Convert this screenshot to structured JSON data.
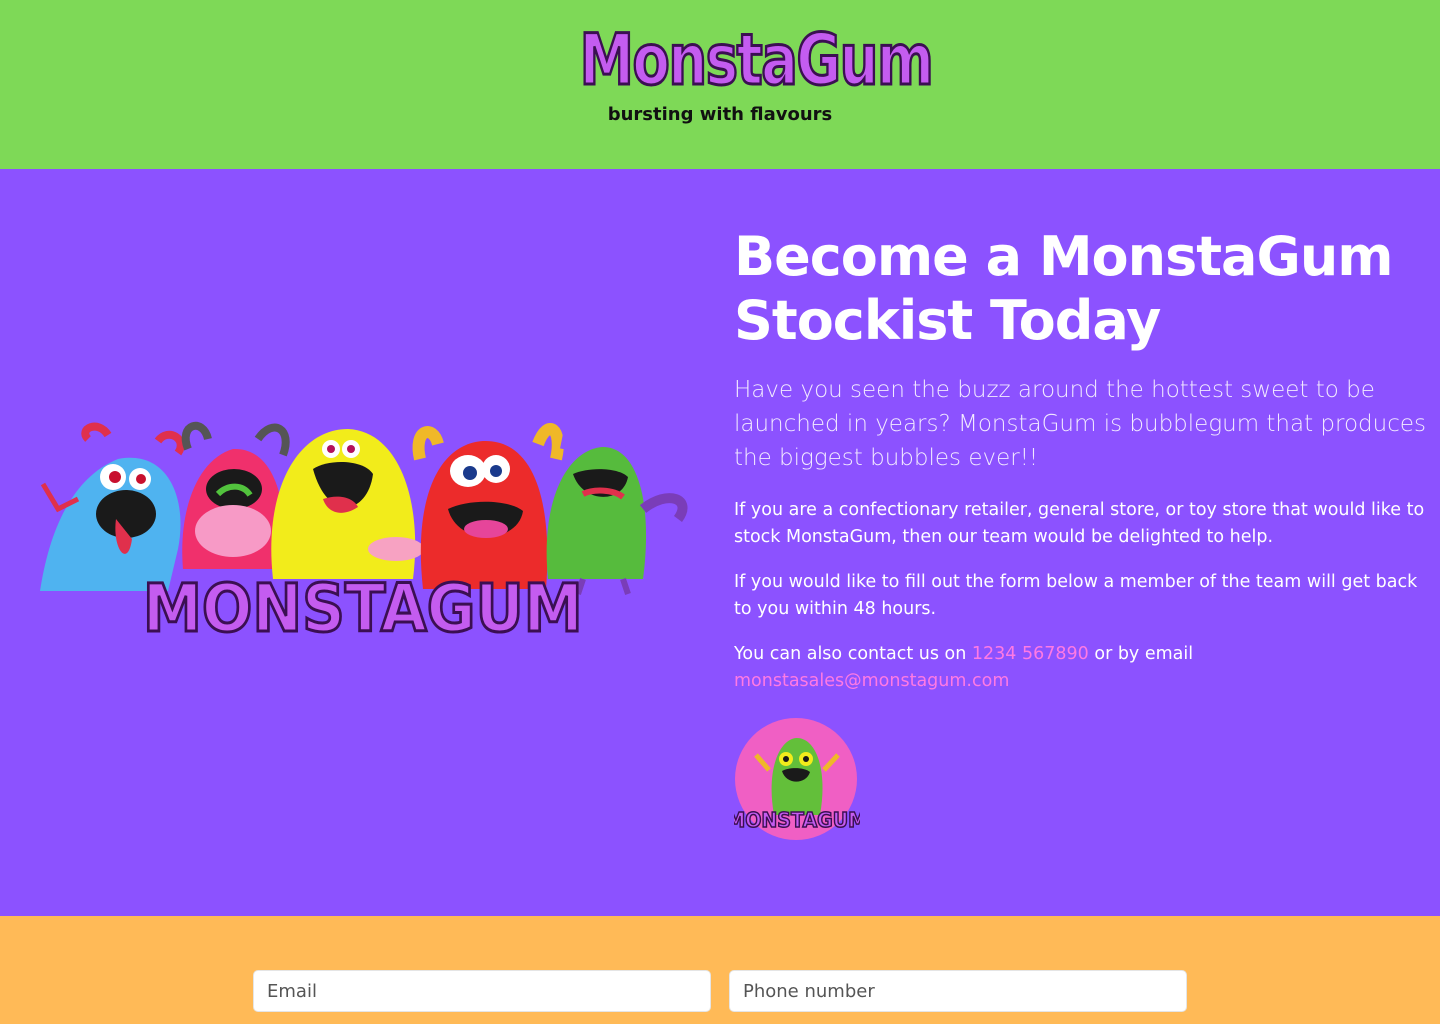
{
  "header": {
    "logo_text": "MonstaGum",
    "tagline": "bursting with flavours",
    "background_color": "#7ed957"
  },
  "hero": {
    "background_color": "#8c52ff",
    "image_logo_text": "MonstaGum",
    "headline": "Become a MonstaGum Stockist Today",
    "lead": "Have you seen the buzz around the hottest sweet to be launched in years? MonstaGum is bubblegum that produces the biggest bubbles ever!!",
    "para1": "If you are a confectionary retailer, general store, or toy store that would like to stock MonstaGum, then our team would be delighted to help.",
    "para2": "If you would like to fill out the form below a member of the team will get back to you within 48 hours.",
    "contact_prefix": "You can also contact us on ",
    "phone": "1234 567890",
    "contact_middle": " or by email ",
    "email": "monstasales@monstagum.com",
    "badge_text": "MonstaGum",
    "link_color": "#ff7ae4"
  },
  "form": {
    "background_color": "#ffba57",
    "email_placeholder": "Email",
    "phone_placeholder": "Phone number"
  }
}
